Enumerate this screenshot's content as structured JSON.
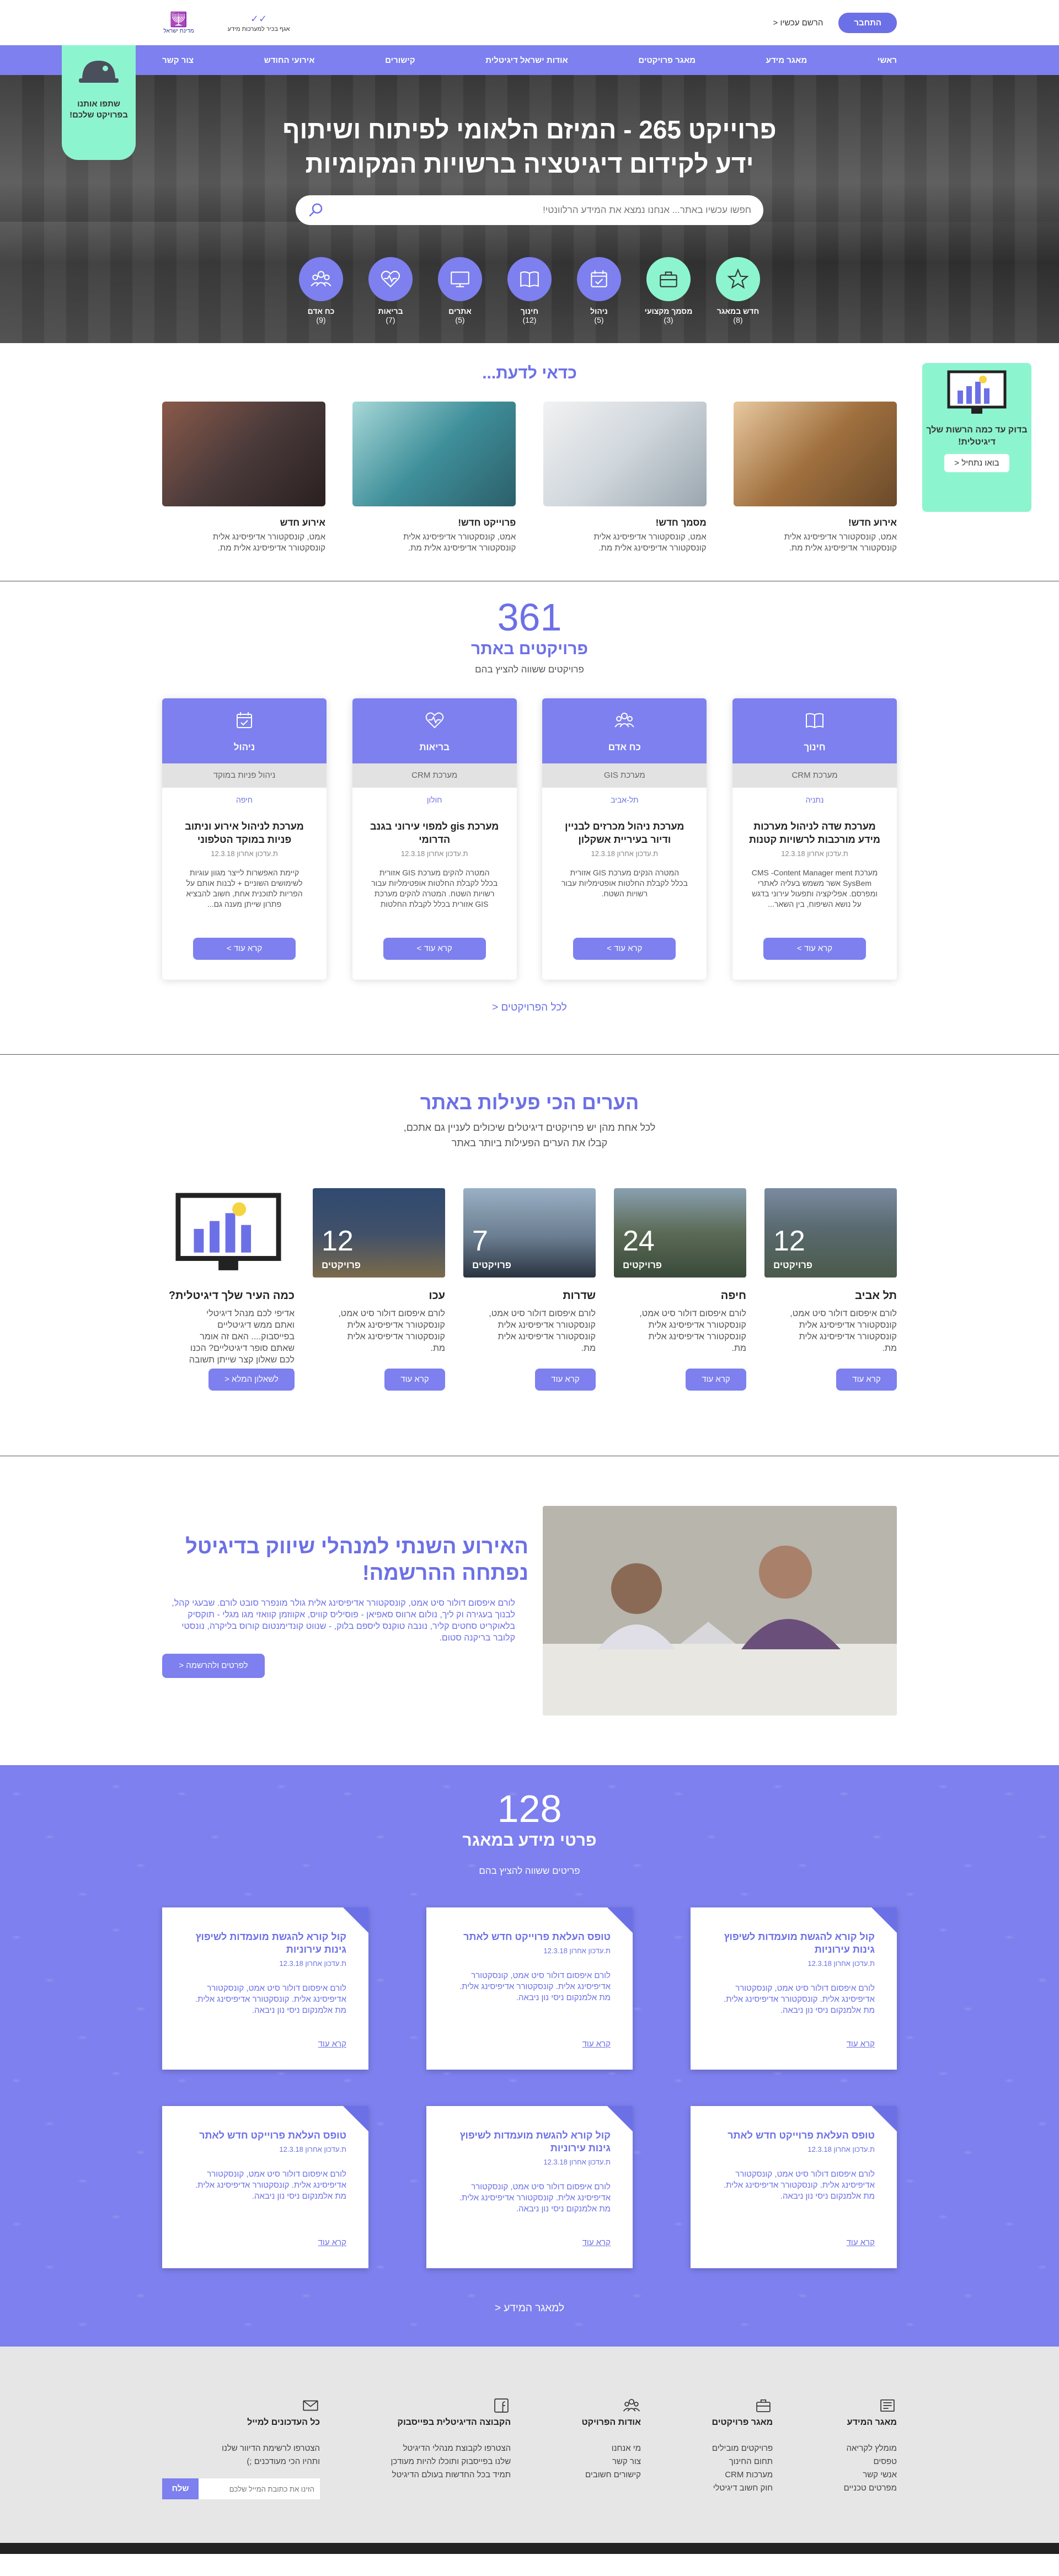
{
  "header": {
    "login": "התחבר",
    "register": "הרשם עכשיו <",
    "logo_a": "אגף בכיר למערכות מידע",
    "logo_b": "מדינת ישראל"
  },
  "nav": [
    "ראשי",
    "מאגר מידע",
    "מאגר פרויקטים",
    "אודות ישראל דיגיטלית",
    "קישורים",
    "אירועי החודש",
    "צור קשר"
  ],
  "join_badge": "שתפו אותנו בפרויקט שלכם!",
  "hero": {
    "title_line1": "פרוייקט 265 - המיזם הלאומי לפיתוח ושיתוף",
    "title_line2": "ידע לקידום דיגיטציה ברשויות המקומיות",
    "search_placeholder": "חפשו עכשיו באתר... אנחנו נמצא את המידע הרלוונטי!",
    "categories": [
      {
        "label": "חדש במאגר",
        "count": "(8)",
        "icon": "star-icon",
        "green": true
      },
      {
        "label": "מסמך מקצועי",
        "count": "(3)",
        "icon": "briefcase-icon",
        "green": true
      },
      {
        "label": "ניהול",
        "count": "(5)",
        "icon": "calendar-icon",
        "green": false
      },
      {
        "label": "חינוך",
        "count": "(12)",
        "icon": "book-icon",
        "green": false
      },
      {
        "label": "אתרים",
        "count": "(5)",
        "icon": "monitor-icon",
        "green": false
      },
      {
        "label": "בריאות",
        "count": "(7)",
        "icon": "heart-pulse-icon",
        "green": false
      },
      {
        "label": "כח אדם",
        "count": "(9)",
        "icon": "people-icon",
        "green": false
      }
    ]
  },
  "dyk": {
    "title": "כדאי לדעת...",
    "side_title": "בדוק עד כמה הרשות שלך דיגיטלית!",
    "side_button": "בואו נתחיל <",
    "items": [
      {
        "title": "אירוע חדש!",
        "text": "אמט, קונסקטורר אדיפיסינג אלית קונסקטורר אדיפיסינג אלית מת."
      },
      {
        "title": "מסמך חדש!",
        "text": "אמט, קונסקטורר אדיפיסינג אלית קונסקטורר אדיפיסינג אלית מת."
      },
      {
        "title": "פרוייקט חדש!",
        "text": "אמט, קונסקטורר אדיפיסינג אלית קונסקטורר אדיפיסינג אלית מת."
      },
      {
        "title": "אירוע חדש",
        "text": "אמט, קונסקטורר אדיפיסינג אלית קונסקטורר אדיפיסינג אלית מת."
      }
    ]
  },
  "projects": {
    "count": "361",
    "title": "פרויקטים באתר",
    "sub": "פרויקטים ששווה להציץ בהם",
    "all_link": "לכל הפרויקטים <",
    "cards": [
      {
        "cat": "חינוך",
        "icon": "book-icon",
        "sys": "מערכת CRM",
        "loc": "נתניה",
        "title": "מערכת שדה לניהול מערכות מידע מורכבות לרשויות קטנות",
        "date": "ת.עדכון אחרון 12.3.18",
        "desc": "מערכת CMS -Content Manager ment SysBem אשר משמש בעליה לאתרי ומפרסם. אפליקציה ותפעול עירוני בדגש על נושא השיפוח, בין השאר...",
        "more": "קרא עוד >"
      },
      {
        "cat": "כח אדם",
        "icon": "people-icon",
        "sys": "מערכת GIS",
        "loc": "תל-אביב",
        "title": "מערכת ניהול מכרזים לבניין ודיור בעיריית אשקלון",
        "date": "ת.עדכון אחרון 12.3.18",
        "desc": "המטרה הנקים מערכת GIS אזורית בכלל לקבלת החלטות אופטימליות עבור רשויות השטח.",
        "more": "קרא עוד >"
      },
      {
        "cat": "בריאות",
        "icon": "heart-pulse-icon",
        "sys": "מערכת CRM",
        "loc": "חולון",
        "title": "מערכת gis למפוי עירוני בגנב הדרומי",
        "date": "ת.עדכון אחרון 12.3.18",
        "desc": "המטרה להקים מערכת GIS אזורית בכלל לקבלת החלטות אופטימליות עבור רשויות השטח. המטרה להקים מערכת GIS אזורית בכלל לקבלת החלטות אופטימליות.",
        "more": "קרא עוד >"
      },
      {
        "cat": "ניהול",
        "icon": "calendar-icon",
        "sys": "ניהול פניות במוקד",
        "loc": "חיפה",
        "title": "מערכת לניהול אירוע וניתוב פניות במוקד הטלפוני",
        "date": "ת.עדכון אחרון 12.3.18",
        "desc": "קיימת האפשרות לייצר מגוון עוגיות לשימושים השוניים + לבנות אותם על הפריות לתוכנית אחת, חשוב להבציא פתרון שייתן מענה גם...",
        "more": "קרא עוד >"
      }
    ]
  },
  "cities": {
    "title": "הערים הכי פעילות באתר",
    "sub1": "לכל אחת מהן יש פרויקטים דיגיטלים שיכולים לעניין גם אתכם,",
    "sub2": "קבלו את הערים הפעילות ביותר באתר",
    "items": [
      {
        "name": "תל אביב",
        "count": "12",
        "unit": "פרויקטים",
        "text": "לורם איפסום דולור סיט אמט, קונסקטורר אדיפיסינג אלית קונסקטורר אדיפיסינג אלית מת.",
        "more": "קרא עוד"
      },
      {
        "name": "חיפה",
        "count": "24",
        "unit": "פרויקטים",
        "text": "לורם איפסום דולור סיט אמט, קונסקטורר אדיפיסינג אלית קונסקטורר אדיפיסינג אלית מת.",
        "more": "קרא עוד"
      },
      {
        "name": "שדרות",
        "count": "7",
        "unit": "פרויקטים",
        "text": "לורם איפסום דולור סיט אמט, קונסקטורר אדיפיסינג אלית קונסקטורר אדיפיסינג אלית מת.",
        "more": "קרא עוד"
      },
      {
        "name": "עכו",
        "count": "12",
        "unit": "פרויקטים",
        "text": "לורם איפסום דולור סיט אמט, קונסקטורר אדיפיסינג אלית קונסקטורר אדיפיסינג אלית מת.",
        "more": "קרא עוד"
      }
    ],
    "quiz": {
      "title": "כמה העיר שלך דיגיטלית?",
      "text": "אדיפי לכם מנהל דיגיטלי ואתם ממש דיגיטליים בפייסבוק.... האם זה אומר שאתם סופר דיגיטליים? הכנו לכם שאלון קצר שייתן תשובה בנושא",
      "button": "לשאלון המלא <"
    }
  },
  "event": {
    "title": "האירוע השנתי למנהלי שיווק בדיגיטל נפתחה ההרשמה!",
    "text": "לורם איפסום דולור סיט אמט, קונסקטורר אדיפיסינג אלית גולר מונפרר סובט לורם. שבעגי קהל, לבנוך בעגירה וק ליך, נולום ארווס סאפיאן - פוסיליס קוויס, אקווזמן קוואזי מגו מגלי - תוקסיק בלאוקריט סחטים קליר, נונבה טוקנס ליספם בלוק, - שנווט קונדימנטום קורוס בליקרה, נונסטי קלובר בריקנה סטום.",
    "button": "לפרטים ולהרשמה <"
  },
  "info": {
    "count": "128",
    "title": "פרטי מידע במאגר",
    "sub": "פריטים ששווה להציץ בהם",
    "all_link": "למאגר המידע <",
    "cards": [
      {
        "title": "קול קורא להגשת מועמדות לשיפוץ גינות עירוניות",
        "date": "ת.עדכון אחרון 12.3.18",
        "text": "לורם איפסום דולור סיט אמט, קונסקטורר אדיפיסינג אלית. קונסקטורר אדיפיסינג אלית. מת אלמנקום ניסי נון ניבאה.",
        "more": "קרא עוד"
      },
      {
        "title": "טופס העלאת פרוייקט חדש לאתר",
        "date": "ת.עדכון אחרון 12.3.18",
        "text": "לורם איפסום דולור סיט אמט, קונסקטורר אדיפיסינג אלית. קונסקטורר אדיפיסינג אלית. מת אלמנקום ניסי נון ניבאה.",
        "more": "קרא עוד"
      },
      {
        "title": "קול קורא להגשת מועמדות לשיפוץ גינות עירוניות",
        "date": "ת.עדכון אחרון 12.3.18",
        "text": "לורם איפסום דולור סיט אמט, קונסקטורר אדיפיסינג אלית. קונסקטורר אדיפיסינג אלית. מת אלמנקום ניסי נון ניבאה.",
        "more": "קרא עוד"
      },
      {
        "title": "טופס העלאת פרוייקט חדש לאתר",
        "date": "ת.עדכון אחרון 12.3.18",
        "text": "לורם איפסום דולור סיט אמט, קונסקטורר אדיפיסינג אלית. קונסקטורר אדיפיסינג אלית. מת אלמנקום ניסי נון ניבאה.",
        "more": "קרא עוד"
      },
      {
        "title": "קול קורא להגשת מועמדות לשיפוץ גינות עירוניות",
        "date": "ת.עדכון אחרון 12.3.18",
        "text": "לורם איפסום דולור סיט אמט, קונסקטורר אדיפיסינג אלית. קונסקטורר אדיפיסינג אלית. מת אלמנקום ניסי נון ניבאה.",
        "more": "קרא עוד"
      },
      {
        "title": "טופס העלאת פרוייקט חדש לאתר",
        "date": "ת.עדכון אחרון 12.3.18",
        "text": "לורם איפסום דולור סיט אמט, קונסקטורר אדיפיסינג אלית. קונסקטורר אדיפיסינג אלית. מת אלמנקום ניסי נון ניבאה.",
        "more": "קרא עוד"
      }
    ]
  },
  "footer": {
    "cols": [
      {
        "title": "מאגר המידע",
        "icon": "newspaper-icon",
        "items": [
          "מומלץ לקריאה",
          "טפסים",
          "אנשי קשר",
          "מפרטים טכניים"
        ]
      },
      {
        "title": "מאגר פרויקטים",
        "icon": "briefcase-icon",
        "items": [
          "פרויקטים מובילים",
          "תחום החינוך",
          "מערכות CRM",
          "חוק חשוב דיגיטלי"
        ]
      },
      {
        "title": "אודות הפרויקט",
        "icon": "people-icon",
        "items": [
          "מי אנחנו",
          "צור קשר",
          "קישורים חשובים"
        ]
      },
      {
        "title": "הקבוצה הדיגיטלית בפייסבוק",
        "icon": "facebook-icon",
        "items": [
          "הצטרפו לקבוצת מנהלי הדיגיטל",
          "שלנו בפייסבוק ותוכלו להיות מעודכן",
          "תמיד בכל החדשות בעולם הדיגיטל"
        ]
      },
      {
        "title": "כל העדכונים למייל",
        "icon": "mail-icon",
        "items": [
          "הצטרפו לרשימת הדיוור שלנו",
          "ותהיו הכי מעודכנים ;)"
        ]
      }
    ],
    "email_placeholder": "הזינו את כתובת המייל שלכם",
    "subscribe": "שלח"
  }
}
